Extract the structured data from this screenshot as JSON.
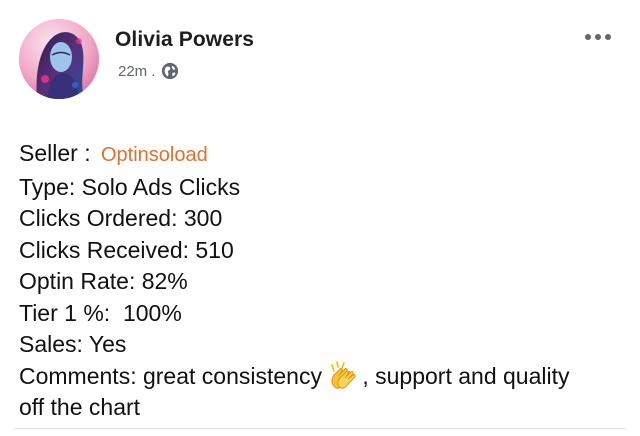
{
  "post": {
    "author": {
      "name": "Olivia Powers",
      "avatar_icon": "avatar-portrait-icon"
    },
    "meta": {
      "time": "22m",
      "separator": ".",
      "audience_icon": "globe-icon"
    },
    "more_icon": "more-options-icon",
    "body": {
      "seller_label": "Seller :",
      "seller_value": "Optinsoload",
      "type": "Type: Solo Ads Clicks",
      "clicks_ordered": "Clicks Ordered: 300",
      "clicks_received": "Clicks Received: 510",
      "optin_rate": "Optin Rate: 82%",
      "tier1": "Tier 1 %:  100%",
      "sales": "Sales: Yes",
      "comments_start": "Comments: great consistency ",
      "comments_emoji": "clapping-hands-icon",
      "comments_end": ", support and quality",
      "comments_line2": "off the chart"
    },
    "colors": {
      "seller_link": "#e0712f",
      "meta_text": "#606770",
      "divider": "#dadde1"
    }
  }
}
